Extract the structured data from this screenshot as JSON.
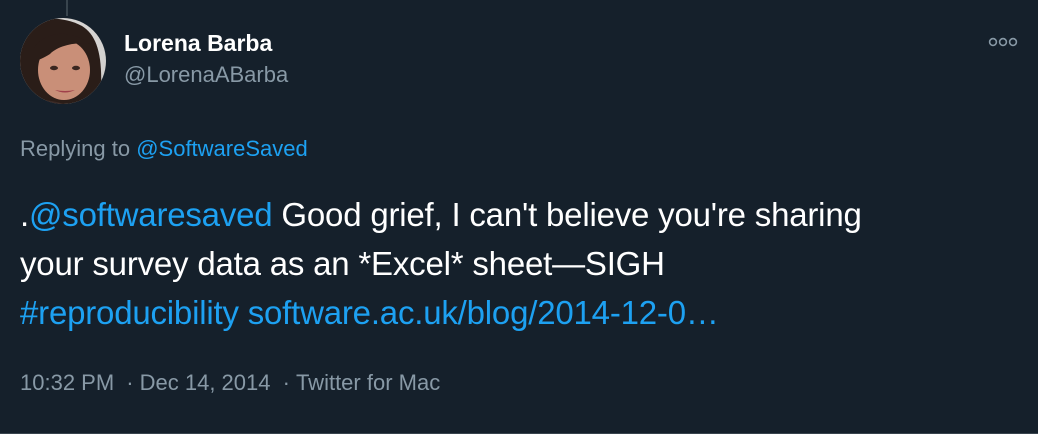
{
  "author": {
    "name": "Lorena Barba",
    "handle": "@LorenaABarba",
    "avatar_icon": "avatar-photo"
  },
  "menu": {
    "icon": "more-options-icon"
  },
  "reply": {
    "prefix": "Replying to",
    "to_handle": "@SoftwareSaved"
  },
  "tweet": {
    "lead": ".",
    "mention": "@softwaresaved",
    "text_line1": " Good grief, I can't believe you're sharing",
    "text_line2": "your survey data as an *Excel* sheet—SIGH",
    "hashtag": "#reproducibility",
    "url": "software.ac.uk/blog/2014-12-0…"
  },
  "meta": {
    "time": "10:32 PM",
    "date": "Dec 14, 2014",
    "source": "Twitter for Mac",
    "separator": "·"
  },
  "colors": {
    "background": "#15202b",
    "link": "#1da1f2",
    "secondary_text": "#8899a6",
    "primary_text": "#ffffff"
  }
}
